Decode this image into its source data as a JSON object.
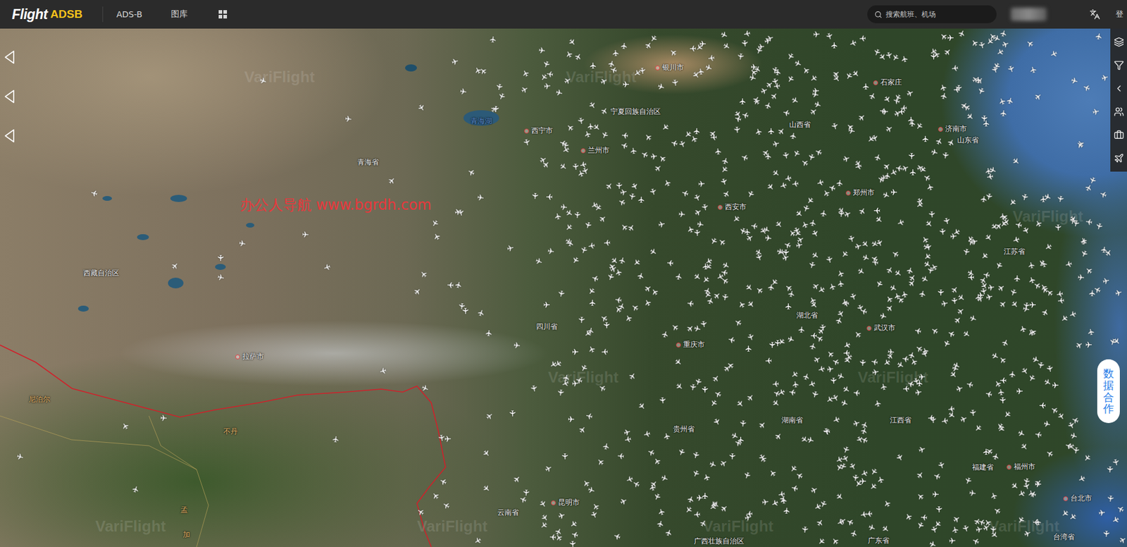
{
  "header": {
    "logo": {
      "brand": "Flight",
      "suffix": "ADSB"
    },
    "nav": [
      {
        "label": "ADS-B"
      },
      {
        "label": "图库"
      }
    ],
    "search": {
      "placeholder": "搜索航班、机场"
    },
    "login": "登"
  },
  "map": {
    "watermark": "办公人导航 www.bgrdh.com",
    "provider_watermark": "VariFlight",
    "labels": [
      {
        "text": "银川市",
        "kind": "city"
      },
      {
        "text": "石家庄",
        "kind": "city"
      },
      {
        "text": "宁夏回族自治区",
        "kind": "region"
      },
      {
        "text": "西宁市",
        "kind": "city"
      },
      {
        "text": "兰州市",
        "kind": "city"
      },
      {
        "text": "青海湖",
        "kind": "lake"
      },
      {
        "text": "青海省",
        "kind": "region"
      },
      {
        "text": "山西省",
        "kind": "region"
      },
      {
        "text": "济南市",
        "kind": "city"
      },
      {
        "text": "山东省",
        "kind": "region"
      },
      {
        "text": "郑州市",
        "kind": "city"
      },
      {
        "text": "西安市",
        "kind": "city"
      },
      {
        "text": "西藏自治区",
        "kind": "region"
      },
      {
        "text": "拉萨市",
        "kind": "city"
      },
      {
        "text": "四川省",
        "kind": "region"
      },
      {
        "text": "重庆市",
        "kind": "city"
      },
      {
        "text": "湖北省",
        "kind": "region"
      },
      {
        "text": "武汉市",
        "kind": "city"
      },
      {
        "text": "江苏省",
        "kind": "region"
      },
      {
        "text": "贵州省",
        "kind": "region"
      },
      {
        "text": "湖南省",
        "kind": "region"
      },
      {
        "text": "江西省",
        "kind": "region"
      },
      {
        "text": "福建省",
        "kind": "region"
      },
      {
        "text": "福州市",
        "kind": "city"
      },
      {
        "text": "昆明市",
        "kind": "city"
      },
      {
        "text": "云南省",
        "kind": "region"
      },
      {
        "text": "台北市",
        "kind": "city"
      },
      {
        "text": "台湾省",
        "kind": "region"
      },
      {
        "text": "广西壮族自治区",
        "kind": "region"
      },
      {
        "text": "广东省",
        "kind": "region"
      },
      {
        "text": "尼泊尔",
        "kind": "country"
      },
      {
        "text": "不丹",
        "kind": "country"
      },
      {
        "text": "孟",
        "kind": "country"
      },
      {
        "text": "加",
        "kind": "country"
      }
    ]
  },
  "side_panel": {
    "cooperation": "数据合作"
  }
}
